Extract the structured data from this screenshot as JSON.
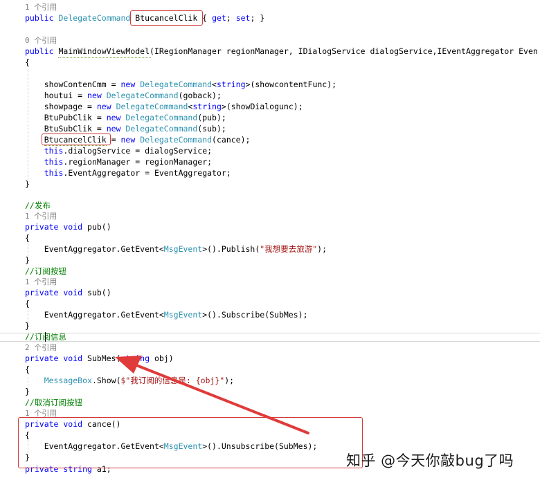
{
  "editor": {
    "lines": {
      "l00": [
        [
          "lens",
          "1 个引用"
        ]
      ],
      "l01": [
        [
          "kw",
          "public "
        ],
        [
          "type",
          "DelegateCommand"
        ],
        [
          "plain",
          " "
        ],
        [
          "plain",
          "BtucancelClik"
        ],
        [
          "plain",
          " { "
        ],
        [
          "kw",
          "get"
        ],
        [
          "plain",
          "; "
        ],
        [
          "kw",
          "set"
        ],
        [
          "plain",
          "; }"
        ]
      ],
      "l02": [
        [
          "lens",
          "0 个引用"
        ]
      ],
      "l03": [
        [
          "kw",
          "public "
        ],
        [
          "plain",
          "MainWindowViewModel(IRegionManager regionManager, IDialogService dialogService,IEventAggregator Even"
        ]
      ],
      "l04": [
        [
          "plain",
          "{"
        ]
      ],
      "l05": [
        [
          "plain",
          "    showContenCmm = "
        ],
        [
          "kw",
          "new "
        ],
        [
          "type",
          "DelegateCommand"
        ],
        [
          "plain",
          "<"
        ],
        [
          "kw",
          "string"
        ],
        [
          "plain",
          ">(showcontentFunc);"
        ]
      ],
      "l06": [
        [
          "plain",
          "    houtui = "
        ],
        [
          "kw",
          "new "
        ],
        [
          "type",
          "DelegateCommand"
        ],
        [
          "plain",
          "(goback);"
        ]
      ],
      "l07": [
        [
          "plain",
          "    showpage = "
        ],
        [
          "kw",
          "new "
        ],
        [
          "type",
          "DelegateCommand"
        ],
        [
          "plain",
          "<"
        ],
        [
          "kw",
          "string"
        ],
        [
          "plain",
          ">(showDialogunc);"
        ]
      ],
      "l08": [
        [
          "plain",
          "    BtuPubClik = "
        ],
        [
          "kw",
          "new "
        ],
        [
          "type",
          "DelegateCommand"
        ],
        [
          "plain",
          "(pub);"
        ]
      ],
      "l09": [
        [
          "plain",
          "    BtuSubClik = "
        ],
        [
          "kw",
          "new "
        ],
        [
          "type",
          "DelegateCommand"
        ],
        [
          "plain",
          "(sub);"
        ]
      ],
      "l10": [
        [
          "plain",
          "    BtucancelClik = "
        ],
        [
          "kw",
          "new "
        ],
        [
          "type",
          "DelegateCommand"
        ],
        [
          "plain",
          "(cance);"
        ]
      ],
      "l11": [
        [
          "plain",
          "    "
        ],
        [
          "kw",
          "this"
        ],
        [
          "plain",
          ".dialogService = dialogService;"
        ]
      ],
      "l12": [
        [
          "plain",
          "    "
        ],
        [
          "kw",
          "this"
        ],
        [
          "plain",
          ".regionManager = regionManager;"
        ]
      ],
      "l13": [
        [
          "plain",
          "    "
        ],
        [
          "kw",
          "this"
        ],
        [
          "plain",
          ".EventAggregator = EventAggregator;"
        ]
      ],
      "l14": [
        [
          "plain",
          "}"
        ]
      ],
      "l15": [
        [
          "comment",
          "//发布"
        ]
      ],
      "l16": [
        [
          "lens",
          "1 个引用"
        ]
      ],
      "l17": [
        [
          "kw",
          "private void "
        ],
        [
          "plain",
          "pub()"
        ]
      ],
      "l18": [
        [
          "plain",
          "{"
        ]
      ],
      "l19": [
        [
          "plain",
          "    EventAggregator.GetEvent<"
        ],
        [
          "type",
          "MsgEvent"
        ],
        [
          "plain",
          ">().Publish("
        ],
        [
          "str",
          "\"我想要去旅游\""
        ],
        [
          "plain",
          ");"
        ]
      ],
      "l20": [
        [
          "plain",
          "}"
        ]
      ],
      "l21": [
        [
          "comment",
          "//订阅按钮"
        ]
      ],
      "l22": [
        [
          "lens",
          "1 个引用"
        ]
      ],
      "l23": [
        [
          "kw",
          "private void "
        ],
        [
          "plain",
          "sub()"
        ]
      ],
      "l24": [
        [
          "plain",
          "{"
        ]
      ],
      "l25": [
        [
          "plain",
          "    EventAggregator.GetEvent<"
        ],
        [
          "type",
          "MsgEvent"
        ],
        [
          "plain",
          ">().Subscribe(SubMes);"
        ]
      ],
      "l26": [
        [
          "plain",
          "}"
        ]
      ],
      "l27": [
        [
          "comment",
          "//订阅信息"
        ]
      ],
      "l28": [
        [
          "lens",
          "2 个引用"
        ]
      ],
      "l29": [
        [
          "kw",
          "private void "
        ],
        [
          "plain",
          "SubMes("
        ],
        [
          "kw",
          "string "
        ],
        [
          "plain",
          "obj)"
        ]
      ],
      "l30": [
        [
          "plain",
          "{"
        ]
      ],
      "l31": [
        [
          "plain",
          "    "
        ],
        [
          "type",
          "MessageBox"
        ],
        [
          "plain",
          ".Show("
        ],
        [
          "str",
          "$\"我订阅的信息是: {obj}\""
        ],
        [
          "plain",
          ");"
        ]
      ],
      "l32": [
        [
          "plain",
          "}"
        ]
      ],
      "l33": [
        [
          "comment",
          "//取消订阅按钮"
        ]
      ],
      "l34": [
        [
          "lens",
          "1 个引用"
        ]
      ],
      "l35": [
        [
          "kw",
          "private void "
        ],
        [
          "plain",
          "cance()"
        ]
      ],
      "l36": [
        [
          "plain",
          "{"
        ]
      ],
      "l37": [
        [
          "plain",
          "    EventAggregator.GetEvent<"
        ],
        [
          "type",
          "MsgEvent"
        ],
        [
          "plain",
          ">().Unsubscribe(SubMes);"
        ]
      ],
      "l38": [
        [
          "plain",
          "}"
        ]
      ],
      "l39": [
        [
          "kw",
          "private string "
        ],
        [
          "plain",
          "a1;"
        ]
      ]
    },
    "colors": {
      "keyword": "#0000ff",
      "type": "#2b91af",
      "comment": "#008000",
      "string": "#a31515",
      "codelens": "#7f7f7f",
      "highlight_box": "#d03a3a",
      "arrow": "#e03a3a"
    }
  },
  "watermark": "知乎 @今天你敲bug了吗"
}
